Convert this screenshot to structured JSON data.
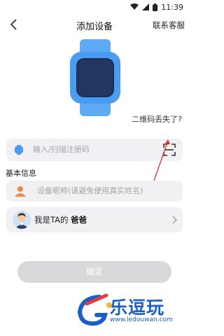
{
  "status_bar": {
    "time": "11:39"
  },
  "header": {
    "title": "添加设备",
    "contact_label": "联系客服"
  },
  "lost_qr_link": "二维码丢失了?",
  "registration": {
    "placeholder": "输入/扫描注册码"
  },
  "section_label": "基本信息",
  "nickname": {
    "placeholder": "设备昵称(请避免使用真实姓名)"
  },
  "relation": {
    "prefix": "我是TA的",
    "value": "爸爸"
  },
  "confirm_label": "确定",
  "watermark": {
    "brand": "乐逗玩",
    "url": "www.ledouwan.com"
  },
  "colors": {
    "accent": "#4a9cf0",
    "watermark": "#1a5fc9",
    "arrow": "#d83030",
    "card_bg": "#f1f1f3",
    "button_disabled": "#d9d9db"
  }
}
